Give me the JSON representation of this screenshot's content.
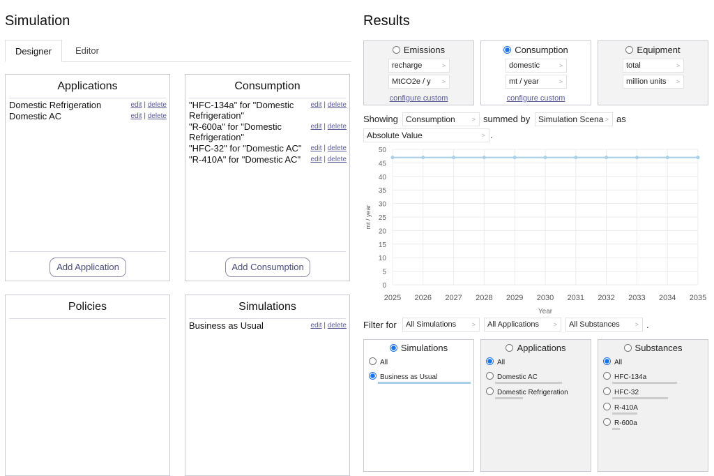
{
  "left": {
    "title": "Simulation",
    "tabs": [
      {
        "label": "Designer"
      },
      {
        "label": "Editor"
      }
    ],
    "applications": {
      "title": "Applications",
      "items": [
        {
          "label": "Domestic Refrigeration"
        },
        {
          "label": "Domestic AC"
        }
      ],
      "add_label": "Add Application"
    },
    "consumption": {
      "title": "Consumption",
      "items": [
        {
          "label": "\"HFC-134a\" for \"Domestic Refrigeration\""
        },
        {
          "label": "\"R-600a\" for \"Domestic Refrigeration\""
        },
        {
          "label": "\"HFC-32\" for \"Domestic AC\""
        },
        {
          "label": "\"R-410A\" for \"Domestic AC\""
        }
      ],
      "add_label": "Add Consumption"
    },
    "policies": {
      "title": "Policies",
      "items": []
    },
    "simulations": {
      "title": "Simulations",
      "items": [
        {
          "label": "Business as Usual"
        }
      ]
    },
    "edit_label": "edit",
    "delete_label": "delete",
    "separator": "|"
  },
  "results": {
    "title": "Results",
    "metrics": [
      {
        "label": "Emissions",
        "selected": false,
        "opt1": "recharge",
        "opt2": "MtCO2e / y",
        "link": "configure custom"
      },
      {
        "label": "Consumption",
        "selected": true,
        "opt1": "domestic",
        "opt2": "mt / year",
        "link": "configure custom"
      },
      {
        "label": "Equipment",
        "selected": false,
        "opt1": "total",
        "opt2": "million units",
        "link": ""
      }
    ],
    "showing_label": "Showing",
    "showing_value": "Consumption",
    "summed_label": "summed by",
    "summed_value": "Simulation Scena",
    "as_label": "as",
    "as_value": "Absolute Value",
    "period": ".",
    "filter_label": "Filter for",
    "filter_sim": "All Simulations",
    "filter_app": "All Applications",
    "filter_sub": "All Substances",
    "arrow": ">",
    "filters": [
      {
        "title": "Simulations",
        "selected": true,
        "options": [
          {
            "label": "All",
            "on": false
          },
          {
            "label": "Business as Usual",
            "on": true,
            "share": 1.0
          }
        ]
      },
      {
        "title": "Applications",
        "selected": false,
        "options": [
          {
            "label": "All",
            "on": true
          },
          {
            "label": "Domestic AC",
            "on": false,
            "share": 0.72
          },
          {
            "label": "Domestic Refrigeration",
            "on": false,
            "share": 0.3
          }
        ]
      },
      {
        "title": "Substances",
        "selected": false,
        "options": [
          {
            "label": "All",
            "on": true
          },
          {
            "label": "HFC-134a",
            "on": false,
            "share": 0.7
          },
          {
            "label": "HFC-32",
            "on": false,
            "share": 0.6
          },
          {
            "label": "R-410A",
            "on": false,
            "share": 0.27
          },
          {
            "label": "R-600a",
            "on": false,
            "share": 0.08
          }
        ]
      }
    ]
  },
  "chart_data": {
    "type": "line",
    "x": [
      2025,
      2026,
      2027,
      2028,
      2029,
      2030,
      2031,
      2032,
      2033,
      2034,
      2035
    ],
    "series": [
      {
        "values": [
          47,
          47,
          47,
          47,
          47,
          47,
          47,
          47,
          47,
          47,
          47
        ]
      }
    ],
    "xlabel": "Year",
    "ylabel": "mt / year",
    "ylim": [
      0,
      50
    ],
    "yticks": [
      0,
      5,
      10,
      15,
      20,
      25,
      30,
      35,
      40,
      45,
      50
    ],
    "grid": true,
    "line_color": "#a9cfe6"
  }
}
